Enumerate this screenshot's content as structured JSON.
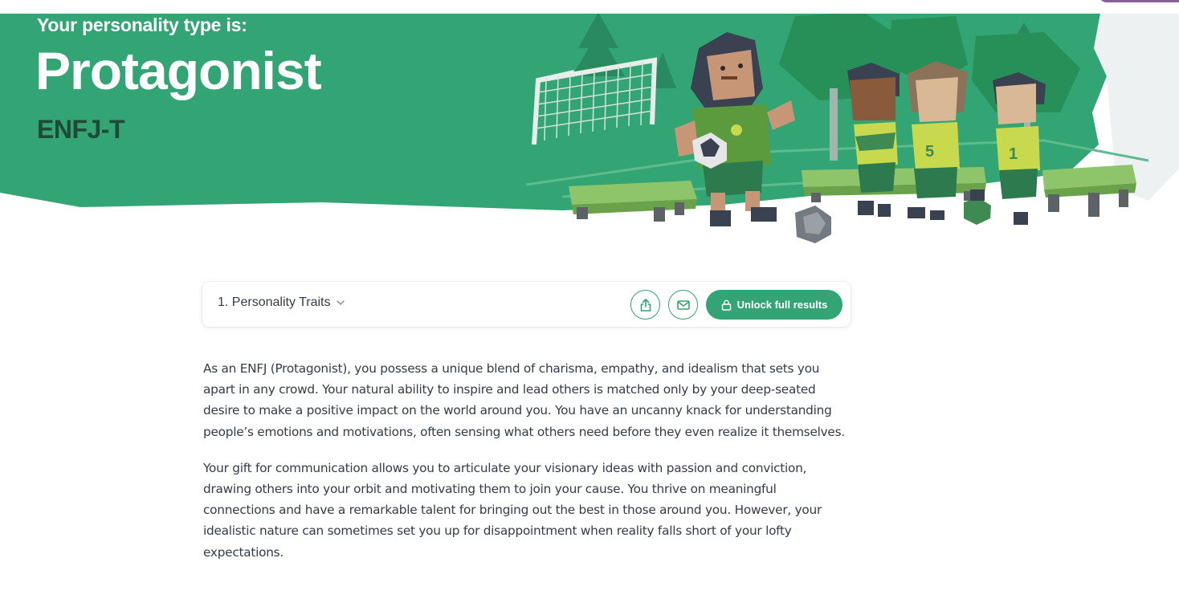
{
  "hero": {
    "subtitle": "Your personality type is:",
    "title": "Protagonist",
    "code": "ENFJ-T",
    "colors": {
      "green": "#33a474",
      "dark_green": "#1e4a37",
      "white": "#ffffff"
    }
  },
  "toolbar": {
    "section_label": "1. Personality Traits",
    "share_icon": "share-icon",
    "email_icon": "email-icon",
    "unlock_label": "Unlock full results",
    "unlock_icon": "lock-icon"
  },
  "content": {
    "paragraphs": [
      "As an ENFJ (Protagonist), you possess a unique blend of charisma, empathy, and idealism that sets you apart in any crowd. Your natural ability to inspire and lead others is matched only by your deep-seated desire to make a positive impact on the world around you. You have an uncanny knack for understanding people’s emotions and motivations, often sensing what others need before they even realize it themselves.",
      "Your gift for communication allows you to articulate your visionary ideas with passion and conviction, drawing others into your orbit and motivating them to join your cause. You thrive on meaningful connections and have a remarkable talent for bringing out the best in those around you. However, your idealistic nature can sometimes set you up for disappointment when reality falls short of your lofty expectations."
    ]
  }
}
